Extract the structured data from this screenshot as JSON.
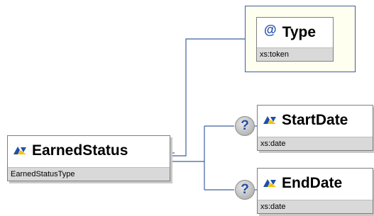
{
  "root": {
    "name": "EarnedStatus",
    "type": "EarnedStatusType"
  },
  "attribute": {
    "symbol": "@",
    "name": "Type",
    "type": "xs:token"
  },
  "children": [
    {
      "name": "StartDate",
      "type": "xs:date",
      "optional_symbol": "?"
    },
    {
      "name": "EndDate",
      "type": "xs:date",
      "optional_symbol": "?"
    }
  ],
  "colors": {
    "connector": "#3f5f9f",
    "element_icon_blue": "#1f4fa8",
    "element_icon_yellow": "#f5c400",
    "subtype_band": "#d9d9d9",
    "attribute_background": "#fffff0"
  },
  "icons": {
    "element": "element-icon",
    "attribute": "attribute-at-icon",
    "optional": "optional-question-icon"
  }
}
